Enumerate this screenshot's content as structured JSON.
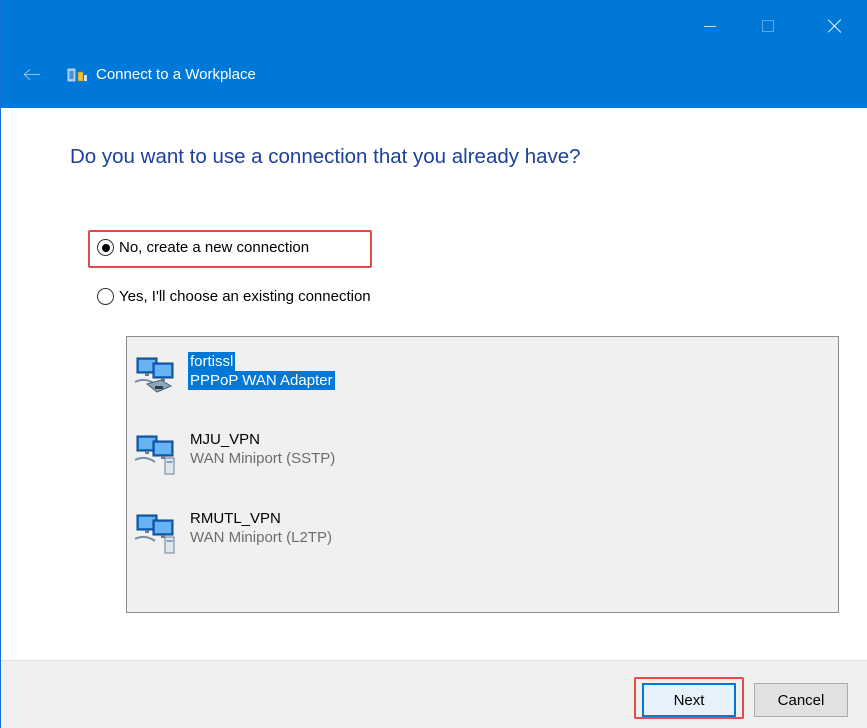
{
  "window": {
    "title": "Connect to a Workplace",
    "controls": {
      "minimize": "minimize-icon",
      "maximize": "maximize-icon",
      "close": "close-icon"
    },
    "back": "back-arrow-icon",
    "accent_color": "#0078d7"
  },
  "heading": "Do you want to use a connection that you already have?",
  "options": [
    {
      "label": "No, create a new connection",
      "selected": true
    },
    {
      "label": "Yes, I'll choose an existing connection",
      "selected": false
    }
  ],
  "connections": [
    {
      "name": "fortissl",
      "device": "PPPoP WAN Adapter",
      "selected": true
    },
    {
      "name": "MJU_VPN",
      "device": "WAN Miniport (SSTP)",
      "selected": false
    },
    {
      "name": "RMUTL_VPN",
      "device": "WAN Miniport (L2TP)",
      "selected": false
    }
  ],
  "footer": {
    "next_label": "Next",
    "cancel_label": "Cancel"
  },
  "highlight_color": "#e34a4a"
}
